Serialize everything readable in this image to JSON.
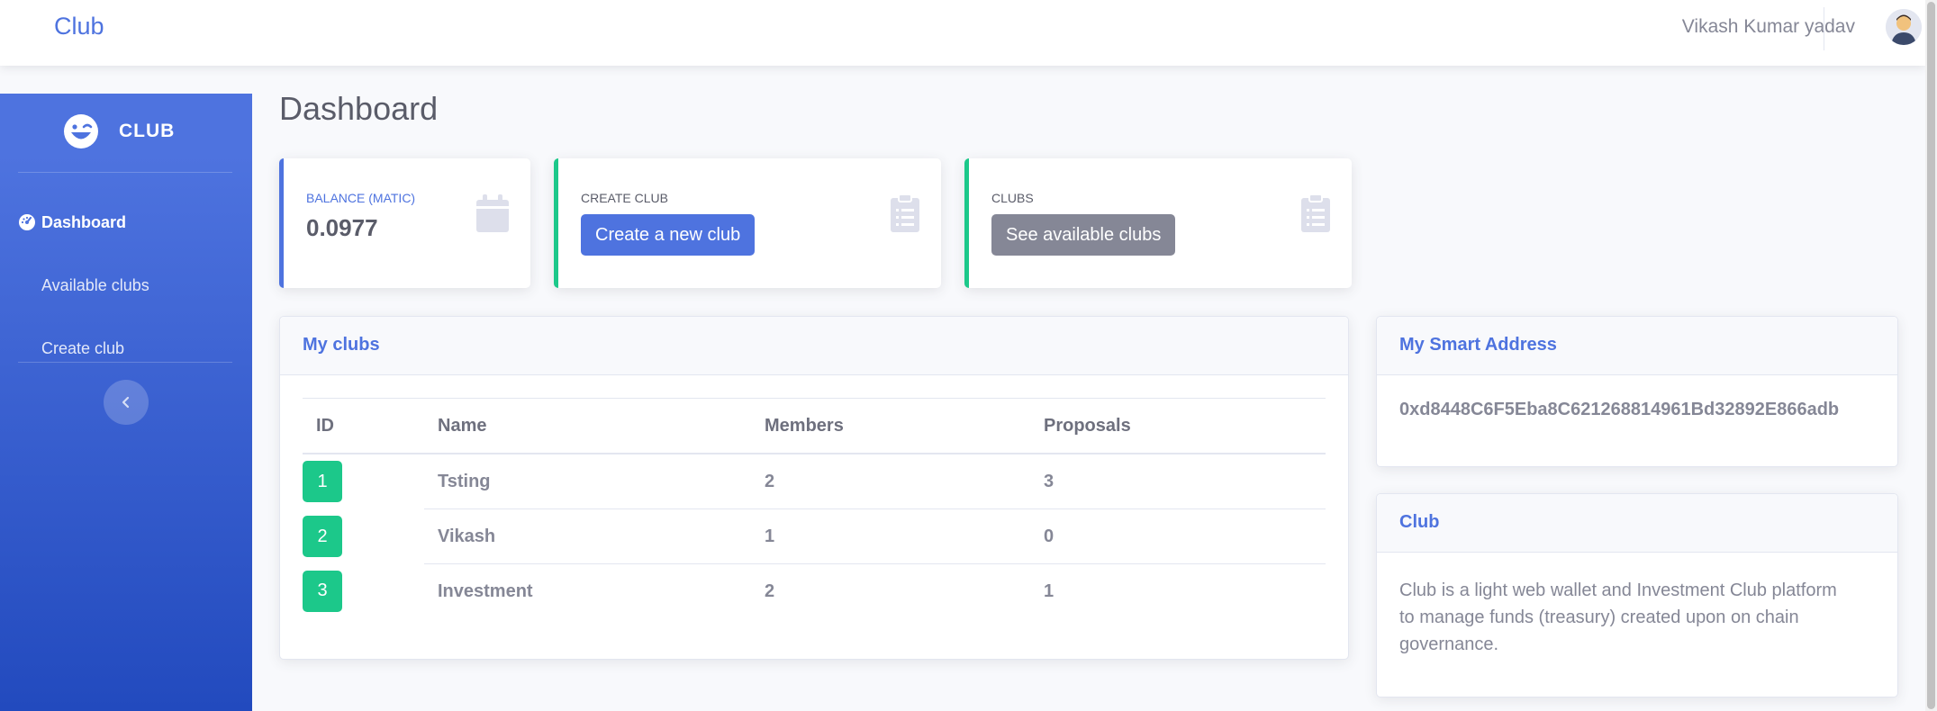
{
  "topbar": {
    "brand": "Club",
    "username": "Vikash Kumar yadav"
  },
  "sidebar": {
    "brand": "CLUB",
    "items": [
      {
        "label": "Dashboard",
        "icon": "tachometer-icon",
        "active": true
      },
      {
        "label": "Available clubs",
        "active": false
      },
      {
        "label": "Create club",
        "active": false
      }
    ],
    "toggle_icon": "chevron-left-icon"
  },
  "main": {
    "title": "Dashboard",
    "stats": [
      {
        "label": "BALANCE (MATIC)",
        "value": "0.0977",
        "icon": "calendar-icon"
      },
      {
        "label": "CREATE CLUB",
        "button": "Create a new club",
        "icon": "clipboard-list-icon"
      },
      {
        "label": "CLUBS",
        "button": "See available clubs",
        "icon": "clipboard-list-icon"
      }
    ],
    "my_clubs": {
      "title": "My clubs",
      "columns": [
        "ID",
        "Name",
        "Members",
        "Proposals"
      ],
      "rows": [
        {
          "id": "1",
          "name": "Tsting",
          "members": "2",
          "proposals": "3"
        },
        {
          "id": "2",
          "name": "Vikash",
          "members": "1",
          "proposals": "0"
        },
        {
          "id": "3",
          "name": "Investment",
          "members": "2",
          "proposals": "1"
        }
      ]
    },
    "smart_address": {
      "title": "My Smart Address",
      "address": "0xd8448C6F5Eba8C621268814961Bd32892E866adb"
    },
    "about": {
      "title": "Club",
      "lines": [
        "Club is a light web wallet and Investment Club platform",
        "to manage funds (treasury) created upon on chain",
        "governance."
      ]
    }
  },
  "colors": {
    "primary": "#4e73df",
    "success": "#1cc88a",
    "secondary": "#858796",
    "text": "#858796",
    "heading": "#5a5c69"
  }
}
